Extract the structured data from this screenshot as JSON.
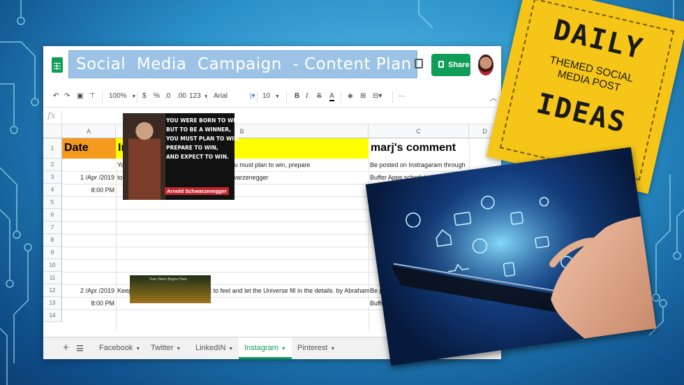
{
  "title_banner": "Social  Media  Campaign  - Content Plan",
  "share_label": "Share",
  "toolbar": {
    "zoom": "100%",
    "currency": "$",
    "percent": "%",
    "dec_less": ".0",
    "dec_more": ".00",
    "format": "123",
    "font": "Arial",
    "size": "10",
    "bold": "B",
    "italic": "I",
    "strike": "S",
    "text_color": "A",
    "more": "···"
  },
  "fx_label": "fx",
  "columns": [
    "A",
    "B",
    "C",
    "D"
  ],
  "rows": [
    "1",
    "2",
    "3",
    "4",
    "5",
    "6",
    "7",
    "8",
    "9",
    "10",
    "11",
    "12",
    "13",
    "14"
  ],
  "headers": {
    "date": "Date",
    "instagram": "Instagram",
    "comment": "marj's comment"
  },
  "cells": {
    "b2": "You are born to win, but to be a winner, you must plan to win, prepare",
    "a3": "1 /Apr /2019",
    "b3": "to win, and expect to win. - by Arnold Schwarzenegger",
    "a4": "8:00 PM",
    "c2": "Be posted on Instragaram through",
    "c3": "Buffer Apps schedule.",
    "a12": "2 /Apr /2019",
    "b12": "Keep your focus on how you want to feel and let the Universe fill in the details. by Abraham",
    "c12": "Be post",
    "a13": "8:00 PM",
    "c13": "Buffer Ap"
  },
  "arnold_image": {
    "quote": "YOU WERE BORN TO WIN,\nBUT TO BE A WINNER,\nYOU MUST PLAN TO WIN,\nPREPARE TO WIN,\nAND EXPECT TO WIN.",
    "signature": "Arnold Schwarzenegger"
  },
  "second_image_text": "Your Vision Begins Here",
  "tabs": [
    {
      "label": "Facebook",
      "active": false
    },
    {
      "label": "Twitter",
      "active": false
    },
    {
      "label": "LinkedIN",
      "active": false
    },
    {
      "label": "Instagram",
      "active": true
    },
    {
      "label": "Pinterest",
      "active": false
    }
  ],
  "ideas_card": {
    "daily": "DAILY",
    "sub": "THEMED SOCIAL\nMEDIA POST",
    "ideas": "IDEAS",
    "color": "#f5c518"
  },
  "colors": {
    "date_header": "#f49a1c",
    "instagram_header": "#ffff00",
    "banner": "#9cc3e6",
    "share": "#0f9d58"
  }
}
